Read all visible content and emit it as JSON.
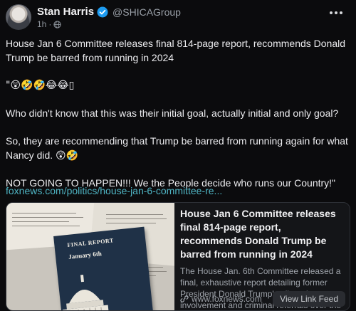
{
  "author": {
    "name": "Stan Harris",
    "handle": "@SHICAGroup",
    "time": "1h",
    "separator": "·"
  },
  "post": {
    "lines": [
      "House Jan 6 Committee releases final 814-page report, recommends Donald Trump be barred from running in 2024",
      "\"😲🤣🤣😂😂▯",
      "Who didn't know that this was their initial goal, actually initial and only goal?",
      "So, they are recommending that Trump be barred from running again for what Nancy did. 😲🤣",
      "NOT GOING TO HAPPEN!!! We the People decide who runs our Country!\""
    ],
    "link": "foxnews.com/politics/house-jan-6-committee-re..."
  },
  "card": {
    "title": "House Jan 6 Committee releases final 814-page report, recommends Donald Trump be barred from running in 2024",
    "description": "The House Jan. 6th Committee released a final, exhaustive report detailing former President Donald Trump's alleged involvement and criminal referrals over the Capitol...",
    "domain": "www.foxnews.com",
    "button": "View Link Feed",
    "image_title": "FINAL REPORT",
    "image_date": "January 6th"
  },
  "icons": {
    "verified": "verified-badge-icon",
    "audience": "globe-icon",
    "more": "more-options-icon",
    "link": "link-icon"
  },
  "colors": {
    "background": "#0b0b0d",
    "link": "#4fb5c4",
    "verified": "#1d9bf0"
  }
}
